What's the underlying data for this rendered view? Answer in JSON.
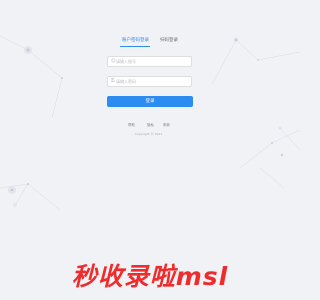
{
  "tabs": {
    "account_login": "账户密码登录",
    "scan_login": "扫码登录"
  },
  "form": {
    "username_placeholder": "请输入账号",
    "password_placeholder": "请输入密码",
    "user_icon": "user-icon",
    "lock_icon": "lock-icon",
    "login_label": "登录"
  },
  "footer": {
    "help": "帮助",
    "privacy": "隐私",
    "terms": "条款",
    "copyright": "Copyright © 2021"
  },
  "watermark": "秒收录啦msl",
  "colors": {
    "accent": "#2d8cf0",
    "background": "#f1f2f6",
    "watermark": "#ef2b2b"
  }
}
